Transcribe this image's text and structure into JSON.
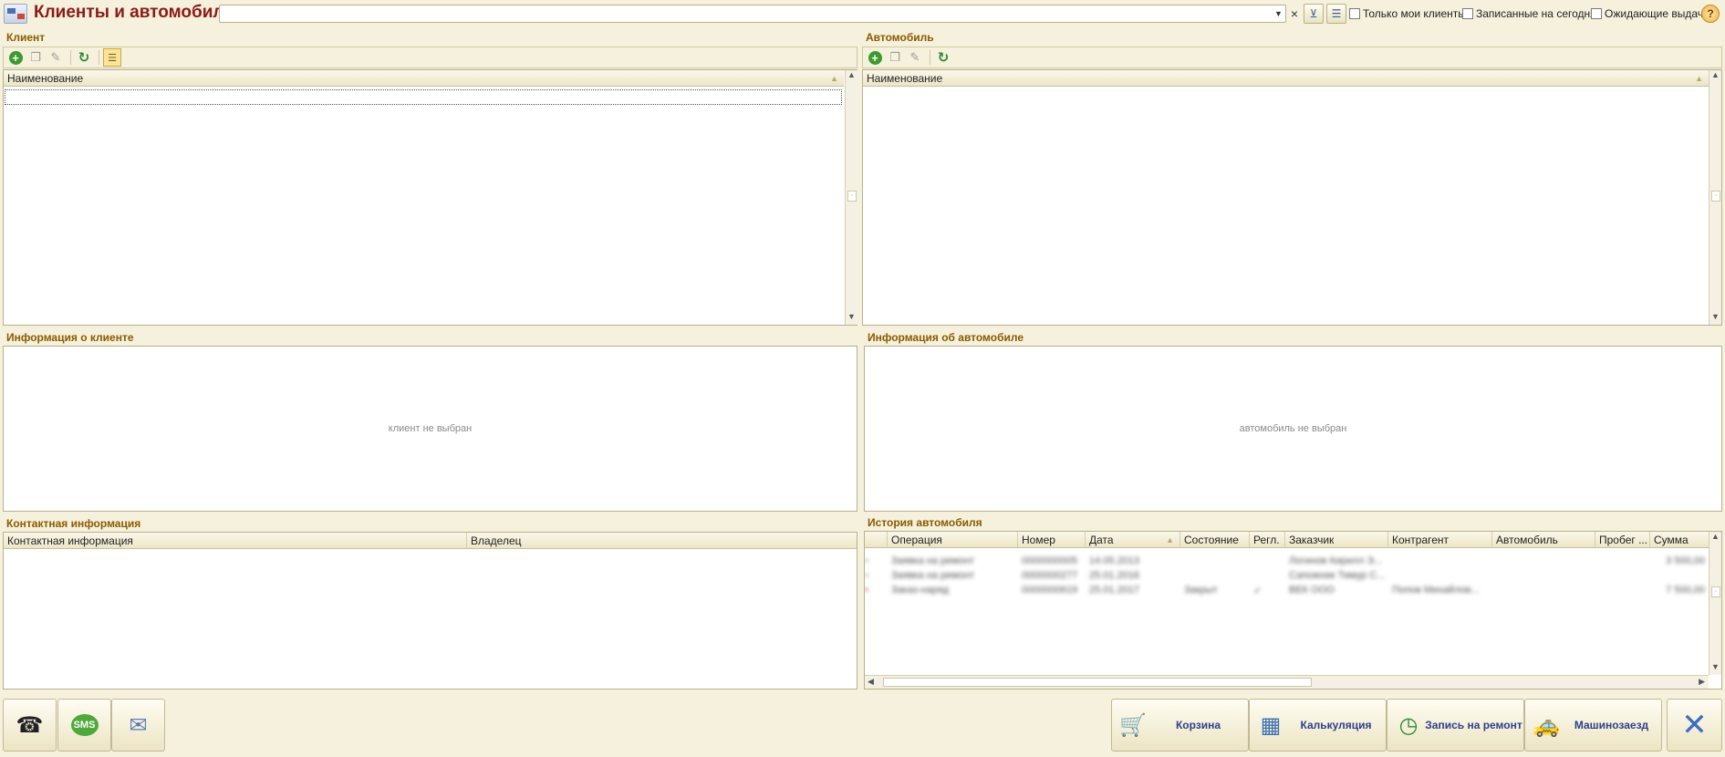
{
  "header": {
    "title": "Клиенты и автомобили",
    "search_value": "",
    "filters": {
      "only_my_clients": "Только мои клиенты",
      "booked_today": "Записанные на сегодня",
      "awaiting_pickup": "Ожидающие выдачи"
    },
    "help_glyph": "?"
  },
  "client": {
    "title": "Клиент",
    "column": "Наименование"
  },
  "car": {
    "title": "Автомобиль",
    "column": "Наименование"
  },
  "client_info": {
    "title": "Информация о клиенте",
    "empty": "клиент не выбран"
  },
  "car_info": {
    "title": "Информация об автомобиле",
    "empty": "автомобиль не выбран"
  },
  "contacts": {
    "title": "Контактная информация",
    "columns": [
      "Контактная информация",
      "Владелец"
    ]
  },
  "history": {
    "title": "История автомобиля",
    "columns": [
      "Операция",
      "Номер",
      "Дата",
      "Состояние",
      "Регл.",
      "Заказчик",
      "Контрагент",
      "Автомобиль",
      "Пробег ...",
      "Сумма"
    ],
    "rows": [
      [
        "Заявка на ремонт",
        "0000000005",
        "14.05.2013",
        "",
        "",
        "Логинов Кирилл Э...",
        "",
        "",
        "",
        "3 500,00"
      ],
      [
        "Заявка на ремонт",
        "0000000277",
        "25.01.2016",
        "",
        "",
        "Сапожник Тимур С...",
        "",
        "",
        "",
        ""
      ],
      [
        "Заказ-наряд",
        "0000000619",
        "25.01.2017",
        "Закрыт",
        "✓",
        "ВЕК ООО",
        "Попов Михайлов...",
        "",
        "",
        "7 500,00"
      ]
    ]
  },
  "actions": {
    "cart": "Корзина",
    "calc": "Калькуляция",
    "booking": "Запись на ремонт",
    "car_arrival": "Машинозаезд"
  }
}
